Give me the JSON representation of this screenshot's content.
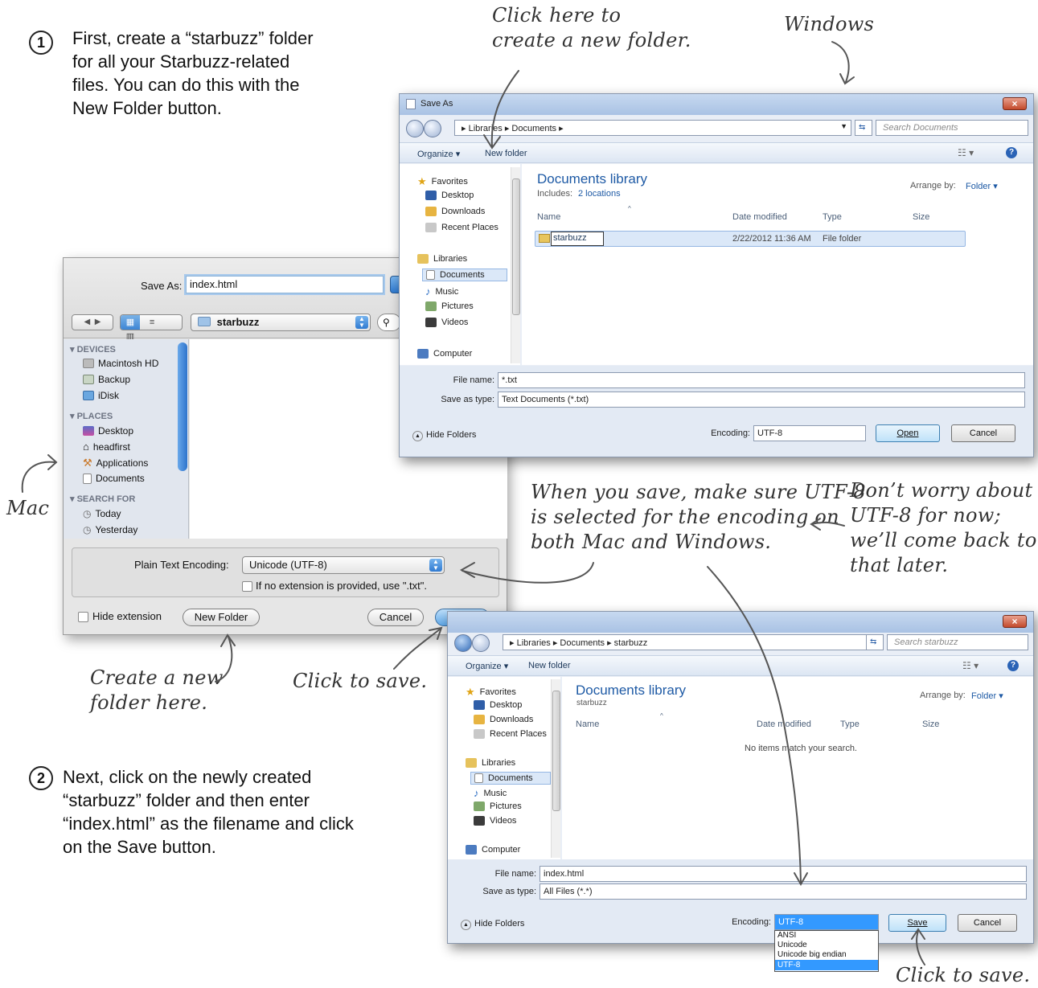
{
  "step1": {
    "number": "1",
    "text": "First, create a “starbuzz” folder\nfor all your Starbuzz-related\nfiles. You can do this with the\nNew Folder button."
  },
  "step2": {
    "number": "2",
    "text": " Next, click on the newly created\n“starbuzz” folder and then enter\n“index.html” as the filename and click\n on the Save button."
  },
  "annotations": {
    "click_new_folder": "Click here to\ncreate a new folder.",
    "windows": "Windows",
    "mac": "Mac",
    "utf8_note": "When you save, make sure UTF-8\nis selected for the encoding on\nboth Mac and Windows.",
    "dont_worry": "Don’t worry about\nUTF-8 for now;\nwe’ll come back to\nthat later.",
    "create_folder_here": "Create a new\nfolder here.",
    "click_to_save_mac": "Click to save.",
    "click_to_save_win": "Click to save."
  },
  "win1": {
    "title": "Save As",
    "close": "×",
    "address": "▸  Libraries  ▸  Documents  ▸",
    "search_placeholder": "Search Documents",
    "organize": "Organize ▾",
    "new_folder": "New folder",
    "nav": {
      "favorites": "Favorites",
      "desktop": "Desktop",
      "downloads": "Downloads",
      "recent": "Recent Places",
      "libraries": "Libraries",
      "documents": "Documents",
      "music": "Music",
      "pictures": "Pictures",
      "videos": "Videos",
      "computer": "Computer"
    },
    "lib_title": "Documents library",
    "includes_label": "Includes:",
    "includes_link": "2 locations",
    "arrange_label": "Arrange by:",
    "arrange_value": "Folder ▾",
    "columns": {
      "name": "Name",
      "date": "Date modified",
      "type": "Type",
      "size": "Size"
    },
    "row": {
      "name": "starbuzz",
      "date": "2/22/2012 11:36 AM",
      "type": "File folder"
    },
    "file_name_label": "File name:",
    "file_name_value": "*.txt",
    "save_type_label": "Save as type:",
    "save_type_value": "Text Documents (*.txt)",
    "hide_folders": "Hide Folders",
    "encoding_label": "Encoding:",
    "encoding_value": "UTF-8",
    "open": "Open",
    "cancel": "Cancel"
  },
  "mac": {
    "save_as_label": "Save As:",
    "save_as_value": "index.html",
    "folder": "starbuzz",
    "devices": "DEVICES",
    "macintosh_hd": "Macintosh HD",
    "backup": "Backup",
    "idisk": "iDisk",
    "places": "PLACES",
    "desktop": "Desktop",
    "headfirst": "headfirst",
    "applications": "Applications",
    "documents": "Documents",
    "search_for": "SEARCH FOR",
    "today": "Today",
    "yesterday": "Yesterday",
    "encoding_label": "Plain Text Encoding:",
    "encoding_value": "Unicode (UTF-8)",
    "ext_check": "If no extension is provided, use \".txt\".",
    "hide_ext": "Hide extension",
    "new_folder": "New Folder",
    "cancel": "Cancel",
    "save": "Save"
  },
  "win2": {
    "close": "×",
    "address": "▸  Libraries  ▸  Documents  ▸  starbuzz",
    "search_placeholder": "Search starbuzz",
    "organize": "Organize ▾",
    "new_folder": "New folder",
    "nav": {
      "favorites": "Favorites",
      "desktop": "Desktop",
      "downloads": "Downloads",
      "recent": "Recent Places",
      "libraries": "Libraries",
      "documents": "Documents",
      "music": "Music",
      "pictures": "Pictures",
      "videos": "Videos",
      "computer": "Computer"
    },
    "lib_title": "Documents library",
    "lib_sub": "starbuzz",
    "arrange_label": "Arrange by:",
    "arrange_value": "Folder ▾",
    "columns": {
      "name": "Name",
      "date": "Date modified",
      "type": "Type",
      "size": "Size"
    },
    "empty": "No items match your search.",
    "file_name_label": "File name:",
    "file_name_value": "index.html",
    "save_type_label": "Save as type:",
    "save_type_value": "All Files (*.*)",
    "hide_folders": "Hide Folders",
    "encoding_label": "Encoding:",
    "encoding_value": "UTF-8",
    "encoding_options": [
      "ANSI",
      "Unicode",
      "Unicode big endian",
      "UTF-8"
    ],
    "save": "Save",
    "cancel": "Cancel"
  },
  "colors": {
    "win_blue": "#1e5aa5",
    "mac_blue": "#5fa8e8",
    "selection": "#3399ff"
  }
}
